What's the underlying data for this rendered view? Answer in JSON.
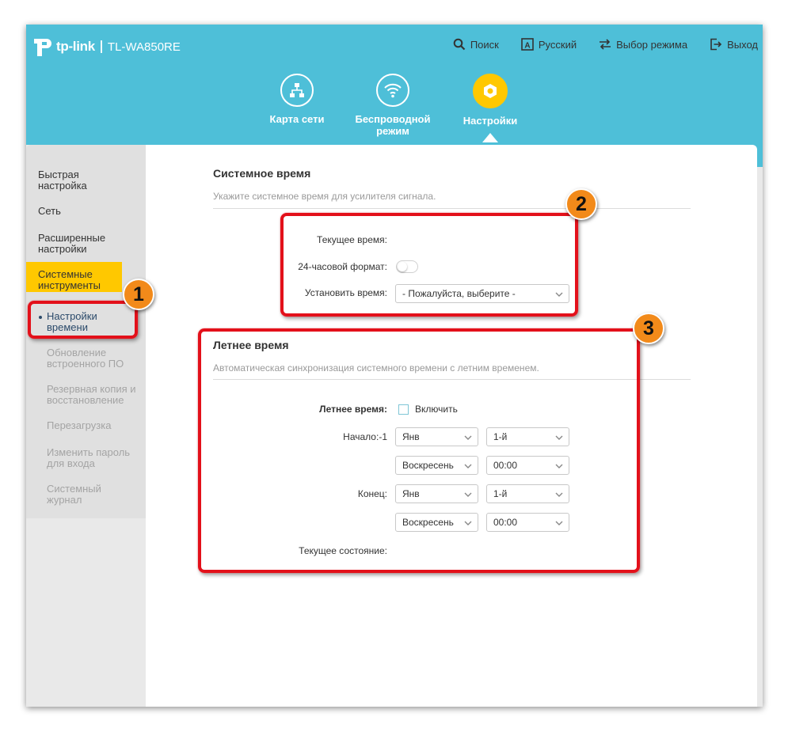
{
  "header": {
    "brand": "tp-link",
    "model": "TL-WA850RE",
    "links": [
      {
        "icon": "search-icon",
        "label": "Поиск"
      },
      {
        "icon": "language-icon",
        "label": "Русский"
      },
      {
        "icon": "mode-switch-icon",
        "label": "Выбор режима"
      },
      {
        "icon": "logout-icon",
        "label": "Выход"
      }
    ],
    "tabs": [
      {
        "icon": "network-map-icon",
        "label": "Карта сети"
      },
      {
        "icon": "wireless-icon",
        "label": "Беспроводной режим"
      },
      {
        "icon": "gear-icon",
        "label": "Настройки",
        "active": true
      }
    ]
  },
  "sidebar": {
    "items": [
      {
        "label": "Быстрая настройка"
      },
      {
        "label": "Сеть"
      },
      {
        "label": "Расширенные настройки"
      },
      {
        "label": "Системные инструменты",
        "active": true
      }
    ],
    "subitems": [
      {
        "label": "Настройки времени",
        "current": true
      },
      {
        "label": "Обновление встроенного ПО"
      },
      {
        "label": "Резервная копия и восстановление"
      },
      {
        "label": "Перезагрузка"
      },
      {
        "label": "Изменить пароль для входа"
      },
      {
        "label": "Системный журнал"
      }
    ]
  },
  "system_time": {
    "title": "Системное время",
    "description": "Укажите системное время для усилителя сигнала.",
    "current_time_label": "Текущее время:",
    "format_label": "24-часовой формат:",
    "set_time_label": "Установить время:",
    "set_time_value": "- Пожалуйста, выберите -"
  },
  "dst": {
    "title": "Летнее время",
    "description": "Автоматическая синхронизация системного времени с летним временем.",
    "dst_label": "Летнее время:",
    "enable_label": "Включить",
    "start_label": "Начало:-1",
    "end_label": "Конец:",
    "start_month": "Янв",
    "start_week": "1-й",
    "start_day": "Воскресенье",
    "start_time": "00:00",
    "end_month": "Янв",
    "end_week": "1-й",
    "end_day": "Воскресенье",
    "end_time": "00:00",
    "status_label": "Текущее состояние:"
  },
  "annotations": [
    "1",
    "2",
    "3"
  ],
  "colors": {
    "header": "#4ebfd8",
    "accent": "#ffc800",
    "annotation": "#e3101a",
    "badge": "#f28a1a"
  }
}
